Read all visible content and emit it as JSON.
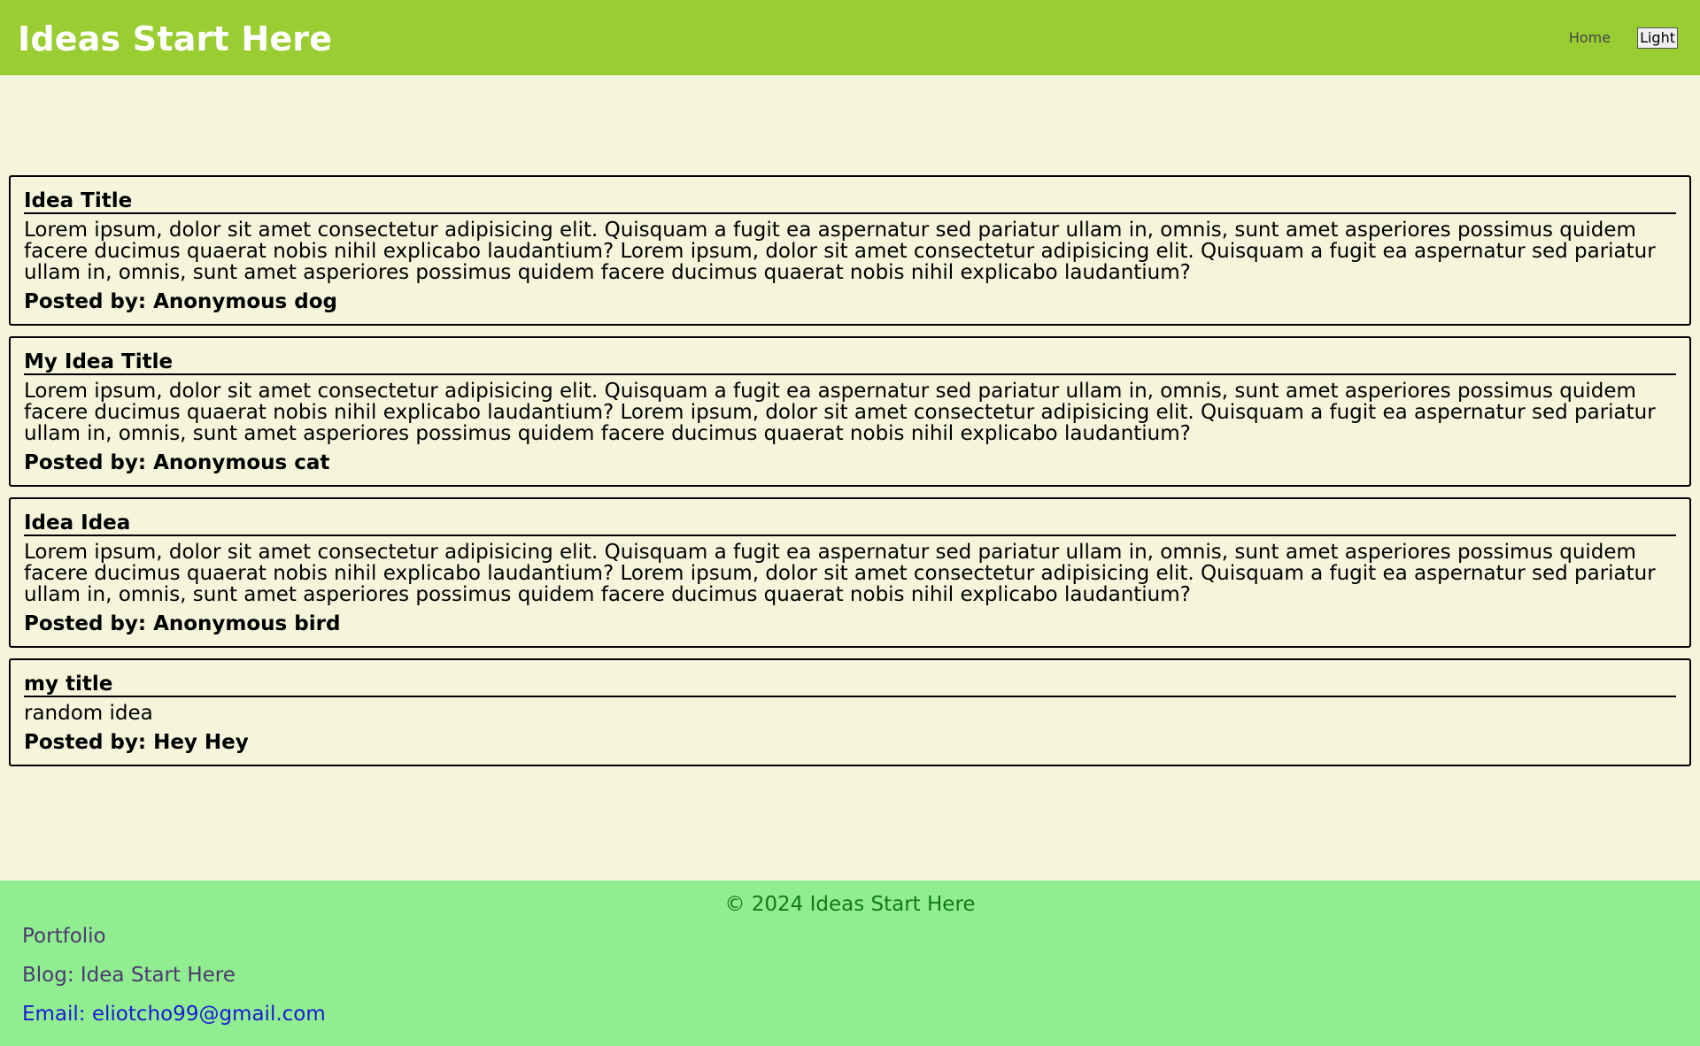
{
  "header": {
    "title": "Ideas Start Here",
    "nav_home": "Home",
    "theme_button": "Light"
  },
  "ideas": [
    {
      "title": "Idea Title",
      "body": "Lorem ipsum, dolor sit amet consectetur adipisicing elit. Quisquam a fugit ea aspernatur sed pariatur ullam in, omnis, sunt amet asperiores possimus quidem facere ducimus quaerat nobis nihil explicabo laudantium? Lorem ipsum, dolor sit amet consectetur adipisicing elit. Quisquam a fugit ea aspernatur sed pariatur ullam in, omnis, sunt amet asperiores possimus quidem facere ducimus quaerat nobis nihil explicabo laudantium?",
      "author": "Posted by: Anonymous dog"
    },
    {
      "title": "My Idea Title",
      "body": "Lorem ipsum, dolor sit amet consectetur adipisicing elit. Quisquam a fugit ea aspernatur sed pariatur ullam in, omnis, sunt amet asperiores possimus quidem facere ducimus quaerat nobis nihil explicabo laudantium? Lorem ipsum, dolor sit amet consectetur adipisicing elit. Quisquam a fugit ea aspernatur sed pariatur ullam in, omnis, sunt amet asperiores possimus quidem facere ducimus quaerat nobis nihil explicabo laudantium?",
      "author": "Posted by: Anonymous cat"
    },
    {
      "title": "Idea Idea",
      "body": "Lorem ipsum, dolor sit amet consectetur adipisicing elit. Quisquam a fugit ea aspernatur sed pariatur ullam in, omnis, sunt amet asperiores possimus quidem facere ducimus quaerat nobis nihil explicabo laudantium? Lorem ipsum, dolor sit amet consectetur adipisicing elit. Quisquam a fugit ea aspernatur sed pariatur ullam in, omnis, sunt amet asperiores possimus quidem facere ducimus quaerat nobis nihil explicabo laudantium?",
      "author": "Posted by: Anonymous bird"
    },
    {
      "title": "my title",
      "body": "random idea",
      "author": "Posted by: Hey Hey"
    }
  ],
  "footer": {
    "copyright": "© 2024 Ideas Start Here",
    "links": {
      "portfolio": "Portfolio",
      "blog": "Blog: Idea Start Here",
      "email": "Email: eliotcho99@gmail.com"
    },
    "colors": {
      "header_bg": "#9acd32",
      "page_bg": "#f5f5dc",
      "footer_bg": "#90ee90"
    }
  }
}
